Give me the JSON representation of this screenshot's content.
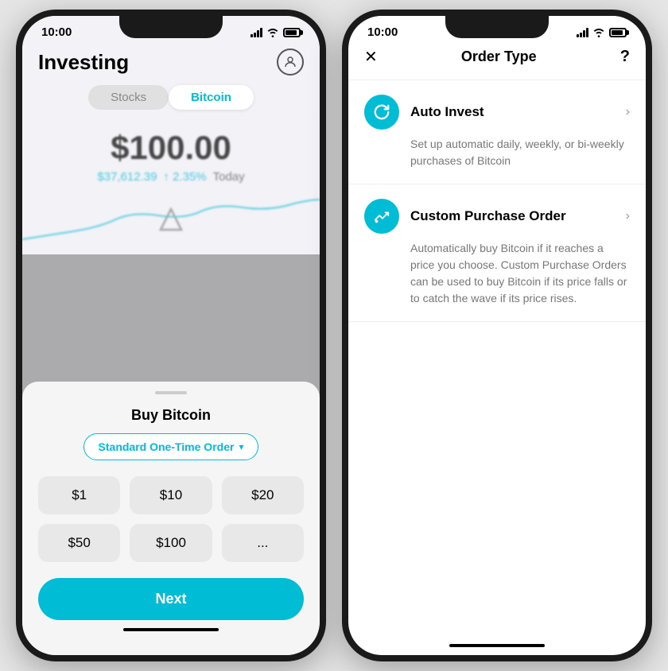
{
  "left_phone": {
    "status_time": "10:00",
    "header_title": "Investing",
    "tabs": [
      {
        "label": "Stocks",
        "active": false
      },
      {
        "label": "Bitcoin",
        "active": true
      }
    ],
    "price_main": "$100.00",
    "price_usd": "$37,612.39",
    "price_change": "↑ 2.35%",
    "price_today": "Today",
    "sheet": {
      "title": "Buy Bitcoin",
      "order_type": "Standard One-Time Order",
      "amounts": [
        "$1",
        "$10",
        "$20",
        "$50",
        "$100",
        "..."
      ],
      "next_label": "Next"
    }
  },
  "right_phone": {
    "status_time": "10:00",
    "header_title": "Order Type",
    "close_label": "✕",
    "help_label": "?",
    "options": [
      {
        "icon": "↻",
        "label": "Auto Invest",
        "desc": "Set up automatic daily, weekly, or bi-weekly purchases of Bitcoin"
      },
      {
        "icon": "≋",
        "label": "Custom Purchase Order",
        "desc": "Automatically buy Bitcoin if it reaches a price you choose. Custom Purchase Orders can be used to buy Bitcoin if its price falls or to catch the wave if its price rises."
      }
    ]
  }
}
